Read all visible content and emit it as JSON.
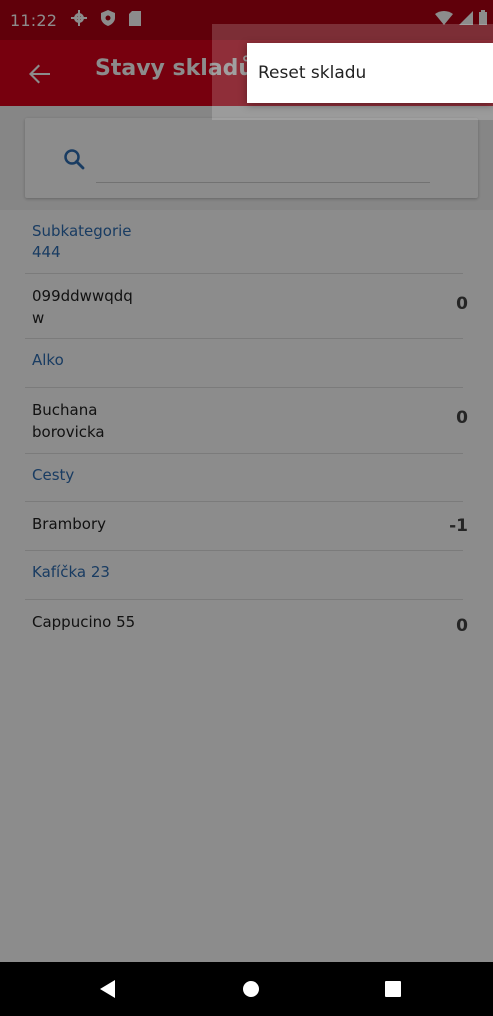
{
  "status_bar": {
    "time": "11:22",
    "icons_left": [
      "settings-icon",
      "shield-icon",
      "sd-card-icon"
    ],
    "icons_right": [
      "wifi-icon",
      "signal-icon",
      "battery-icon"
    ]
  },
  "appbar": {
    "title": "Stavy skladů",
    "back_icon": "arrow-back-icon"
  },
  "search": {
    "value": "",
    "placeholder": ""
  },
  "list": [
    {
      "type": "category",
      "label": "Subkategorie\n444"
    },
    {
      "type": "item",
      "name": "099ddwwqdq\nw",
      "qty": "0"
    },
    {
      "type": "category",
      "label": "Alko"
    },
    {
      "type": "item",
      "name": "Buchana\nborovicka",
      "qty": "0"
    },
    {
      "type": "category",
      "label": "Cesty"
    },
    {
      "type": "item",
      "name": "Brambory",
      "qty": "-1"
    },
    {
      "type": "category",
      "label": "Kafíčka 23"
    },
    {
      "type": "item",
      "name": "Cappucino 55",
      "qty": "0"
    }
  ],
  "overflow_menu": {
    "items": [
      {
        "label": "Reset skladu"
      }
    ]
  },
  "nav_bar": {
    "icons": [
      "nav-back-icon",
      "nav-home-icon",
      "nav-recents-icon"
    ]
  },
  "colors": {
    "primary": "#d9001a",
    "primary_dark": "#b00013",
    "category_text": "#2f6db3"
  }
}
